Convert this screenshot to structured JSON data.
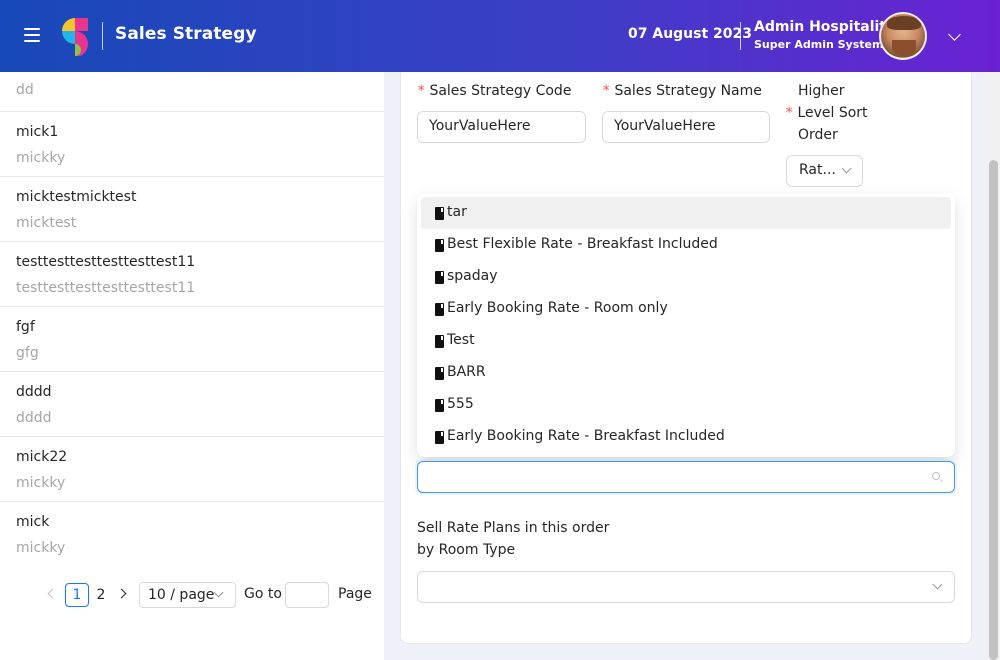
{
  "header": {
    "app_title": "Sales Strategy",
    "date": "07 August 2023",
    "user_name": "Admin Hospitality",
    "user_role": "Super Admin System",
    "colors": {
      "gradient_start": "#1749b8",
      "gradient_end": "#6a22d2"
    }
  },
  "list": {
    "items": [
      {
        "title": "",
        "subtitle": "dd"
      },
      {
        "title": "mick1",
        "subtitle": "mickky"
      },
      {
        "title": "micktestmicktest",
        "subtitle": "micktest"
      },
      {
        "title": "testtesttesttesttesttest11",
        "subtitle": "testtesttesttesttesttest11"
      },
      {
        "title": "fgf",
        "subtitle": "gfg"
      },
      {
        "title": "dddd",
        "subtitle": "dddd"
      },
      {
        "title": "mick22",
        "subtitle": "mickky"
      },
      {
        "title": "mick",
        "subtitle": "mickky"
      }
    ]
  },
  "pagination": {
    "current_page": "1",
    "next_page": "2",
    "page_size": "10 / page",
    "goto_label": "Go to",
    "page_label": "Page"
  },
  "form": {
    "code_label": "Sales Strategy Code",
    "code_value": "YourValueHere",
    "name_label": "Sales Strategy Name",
    "name_value": "YourValueHere",
    "sort_label_line1": "Higher",
    "sort_label_line2": "Level Sort",
    "sort_label_line3": "Order",
    "sort_value": "Rat...",
    "required_mark": "*",
    "dropdown_options": [
      "tar",
      "Best Flexible Rate - Breakfast Included",
      "spaday",
      "Early Booking Rate - Room only",
      "Test",
      "BARR",
      "555",
      "Early Booking Rate - Breakfast Included"
    ],
    "sell_order_label_line1": "Sell Rate Plans in this order",
    "sell_order_label_line2": "by Room Type",
    "accent_color": "#1677ff",
    "required_color": "#ff4d4f"
  }
}
